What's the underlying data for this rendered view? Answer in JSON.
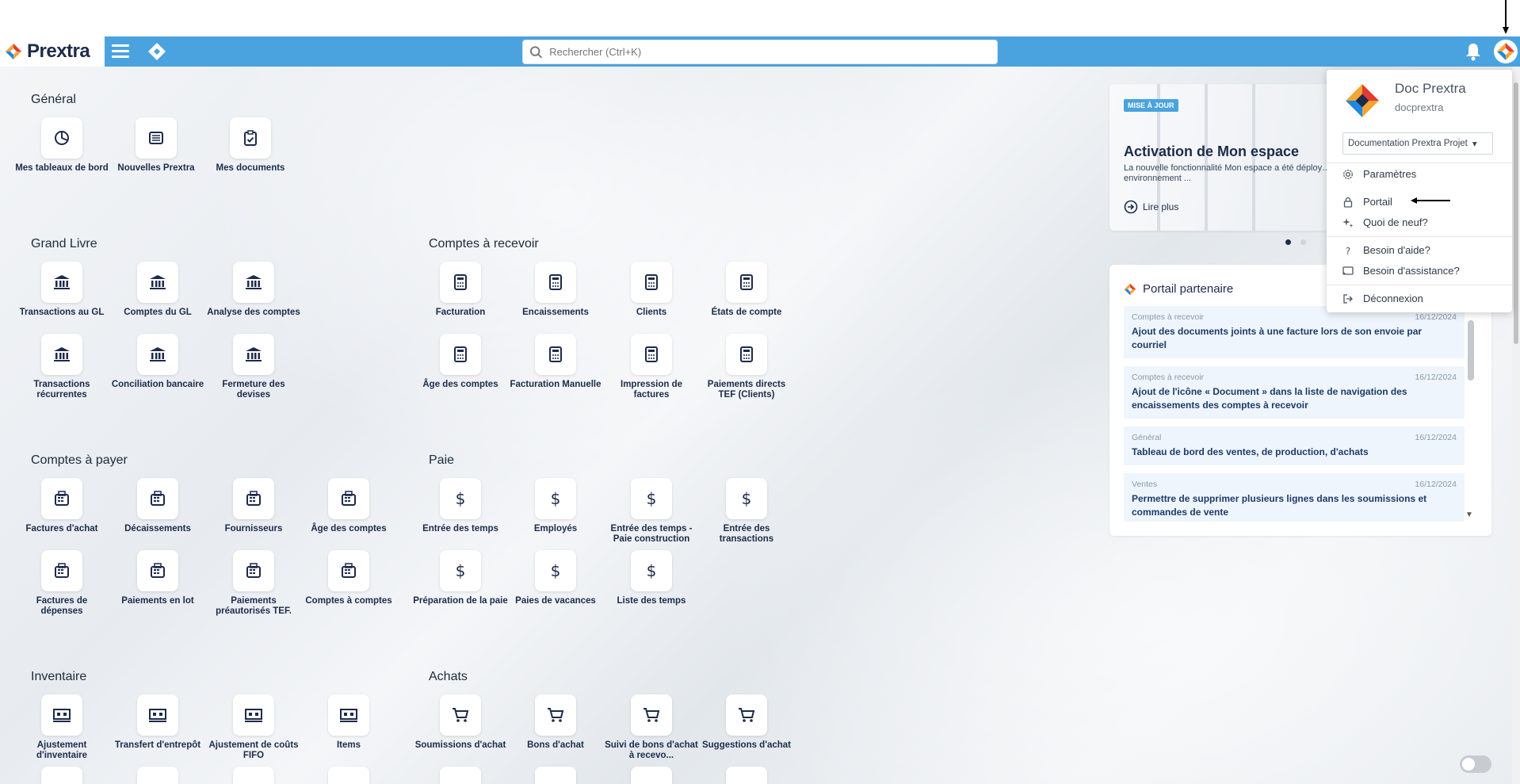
{
  "header": {
    "logo_text": "Prextra",
    "search_placeholder": "Rechercher (Ctrl+K)"
  },
  "sections": [
    {
      "title": "Général",
      "tiles": [
        "Mes tableaux de bord",
        "Nouvelles Prextra",
        "Mes documents"
      ]
    },
    {
      "title": "Grand Livre",
      "tiles": [
        "Transactions au GL",
        "Comptes du GL",
        "Analyse des comptes",
        "Transactions récurrentes",
        "Conciliation bancaire",
        "Fermeture des devises"
      ]
    },
    {
      "title": "Comptes à recevoir",
      "tiles": [
        "Facturation",
        "Encaissements",
        "Clients",
        "États de compte",
        "Âge des comptes",
        "Facturation Manuelle",
        "Impression de factures",
        "Paiements directs TEF (Clients)"
      ]
    },
    {
      "title": "Comptes à payer",
      "tiles": [
        "Factures d'achat",
        "Décaissements",
        "Fournisseurs",
        "Âge des comptes",
        "Factures de dépenses",
        "Paiements en lot",
        "Paiements préautorisés TEF.",
        "Comptes à comptes"
      ]
    },
    {
      "title": "Paie",
      "tiles": [
        "Entrée des temps",
        "Employés",
        "Entrée des temps - Paie construction",
        "Entrée des transactions",
        "Préparation de la paie",
        "Paies de vacances",
        "Liste des temps"
      ]
    },
    {
      "title": "Inventaire",
      "tiles": [
        "Ajustement d'inventaire",
        "Transfert d'entrepôt",
        "Ajustement de coûts FIFO",
        "Items"
      ]
    },
    {
      "title": "Achats",
      "tiles": [
        "Soumissions d'achat",
        "Bons d'achat",
        "Suivi de bons d'achat à recevo...",
        "Suggestions d'achat"
      ]
    }
  ],
  "news": {
    "badge": "MISE À JOUR",
    "title": "Activation de Mon espace",
    "desc": "La nouvelle fonctionnalité Mon espace a été déploy… environnement ...",
    "link": "Lire plus"
  },
  "partner": {
    "title": "Portail partenaire",
    "items": [
      {
        "cat": "Comptes à recevoir",
        "date": "16/12/2024",
        "text": "Ajout des documents joints à une facture lors de son envoie par courriel"
      },
      {
        "cat": "Comptes à recevoir",
        "date": "16/12/2024",
        "text": "Ajout de l'icône « Document » dans la liste de navigation des encaissements des comptes à recevoir"
      },
      {
        "cat": "Général",
        "date": "16/12/2024",
        "text": "Tableau de bord des ventes, de production, d'achats"
      },
      {
        "cat": "Ventes",
        "date": "16/12/2024",
        "text": "Permettre de supprimer plusieurs lignes dans les soumissions et commandes de vente"
      }
    ]
  },
  "user_menu": {
    "name": "Doc Prextra",
    "username": "docprextra",
    "project": "Documentation Prextra Projet",
    "items": [
      "Paramètres",
      "Portail",
      "Quoi de neuf?",
      "Besoin d'aide?",
      "Besoin d'assistance?",
      "Déconnexion"
    ]
  },
  "colors": {
    "header": "#4aa3df",
    "text_dark": "#1d2b4a",
    "accent": "#4aa3df"
  }
}
